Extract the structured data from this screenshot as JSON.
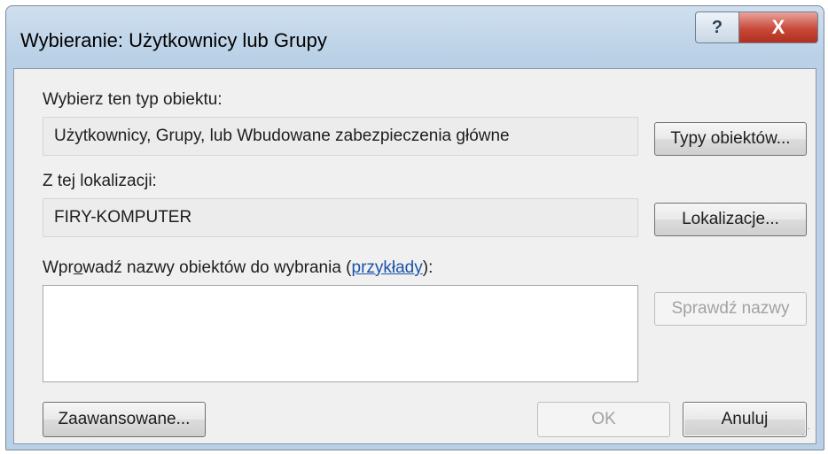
{
  "window": {
    "title": "Wybieranie: Użytkownicy lub Grupy",
    "help_label": "?",
    "close_label": "X"
  },
  "object_type": {
    "label": "Wybierz ten typ obiektu:",
    "value": "Użytkownicy, Grupy, lub Wbudowane zabezpieczenia główne",
    "button": "Typy obiektów..."
  },
  "location": {
    "label": "Z tej lokalizacji:",
    "value": "FIRY-KOMPUTER",
    "button": "Lokalizacje..."
  },
  "names": {
    "label_prefix": "Wpr",
    "label_accel": "o",
    "label_middle": "wadź nazwy obiektów do wybrania (",
    "link": "przykłady",
    "label_suffix": "):",
    "value": "",
    "check_button": "Sprawdź nazwy"
  },
  "footer": {
    "advanced_button": "Zaawansowane...",
    "ok_button": "OK",
    "cancel_button": "Anuluj"
  },
  "colors": {
    "title_bar": "#b9d0e6",
    "close_button": "#c8493a",
    "link": "#1a53a8",
    "disabled_text": "#a2a2a2"
  }
}
